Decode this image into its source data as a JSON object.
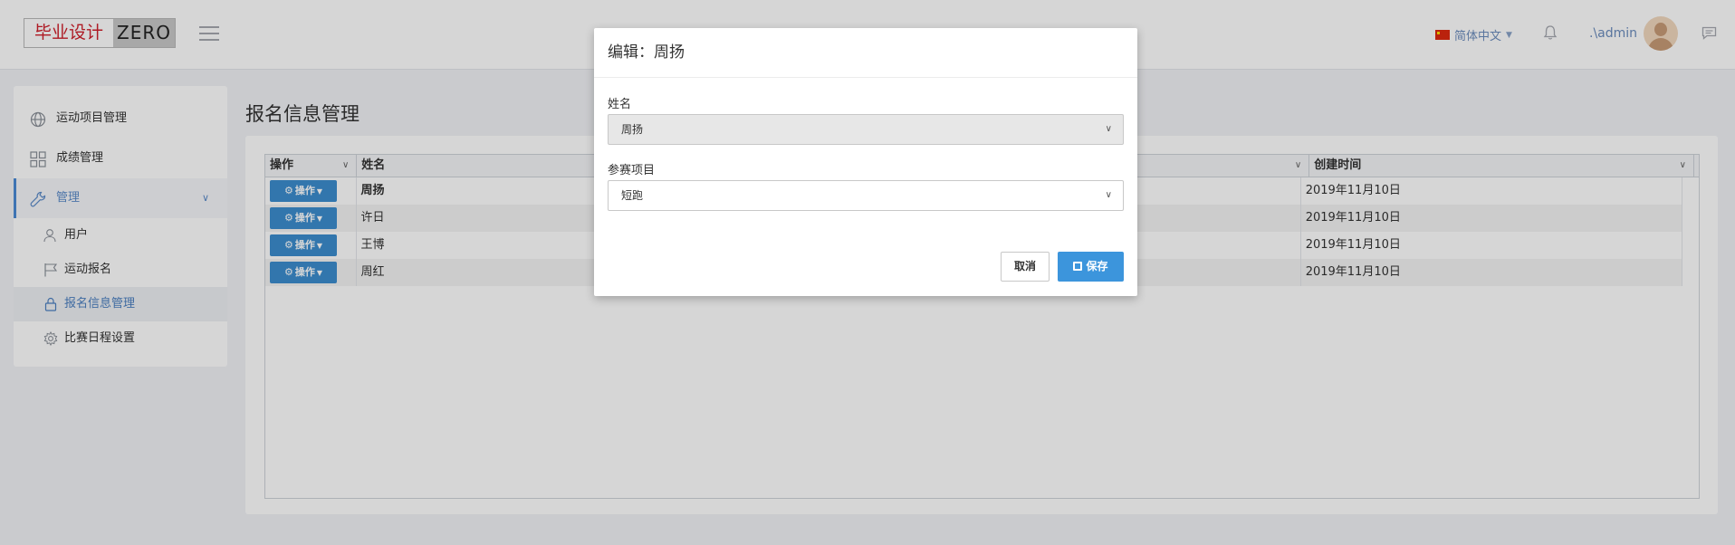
{
  "header": {
    "logo_cn": "毕业设计",
    "logo_en": "ZERO",
    "language": "简体中文",
    "user": ".\\admin"
  },
  "sidebar": {
    "items": [
      {
        "label": "运动项目管理",
        "icon": "globe-icon"
      },
      {
        "label": "成绩管理",
        "icon": "grid-icon"
      },
      {
        "label": "管理",
        "icon": "wrench-icon"
      }
    ],
    "sub_items": [
      {
        "label": "用户",
        "icon": "user-icon"
      },
      {
        "label": "运动报名",
        "icon": "flag-icon"
      },
      {
        "label": "报名信息管理",
        "icon": "lock-icon"
      },
      {
        "label": "比赛日程设置",
        "icon": "gear-icon"
      }
    ]
  },
  "page": {
    "title": "报名信息管理"
  },
  "table": {
    "columns": {
      "op": "操作",
      "name": "姓名",
      "created": "创建时间"
    },
    "op_button_label": "操作",
    "rows": [
      {
        "name": "周扬",
        "created": "2019年11月10日"
      },
      {
        "name": "许日",
        "created": "2019年11月10日"
      },
      {
        "name": "王博",
        "created": "2019年11月10日"
      },
      {
        "name": "周红",
        "created": "2019年11月10日"
      }
    ]
  },
  "modal": {
    "title": "编辑：周扬",
    "name_label": "姓名",
    "name_value": "周扬",
    "event_label": "参赛项目",
    "event_value": "短跑",
    "cancel_label": "取消",
    "save_label": "保存"
  },
  "colors": {
    "accent": "#3c8dcf",
    "logo_red": "#d0202c"
  }
}
